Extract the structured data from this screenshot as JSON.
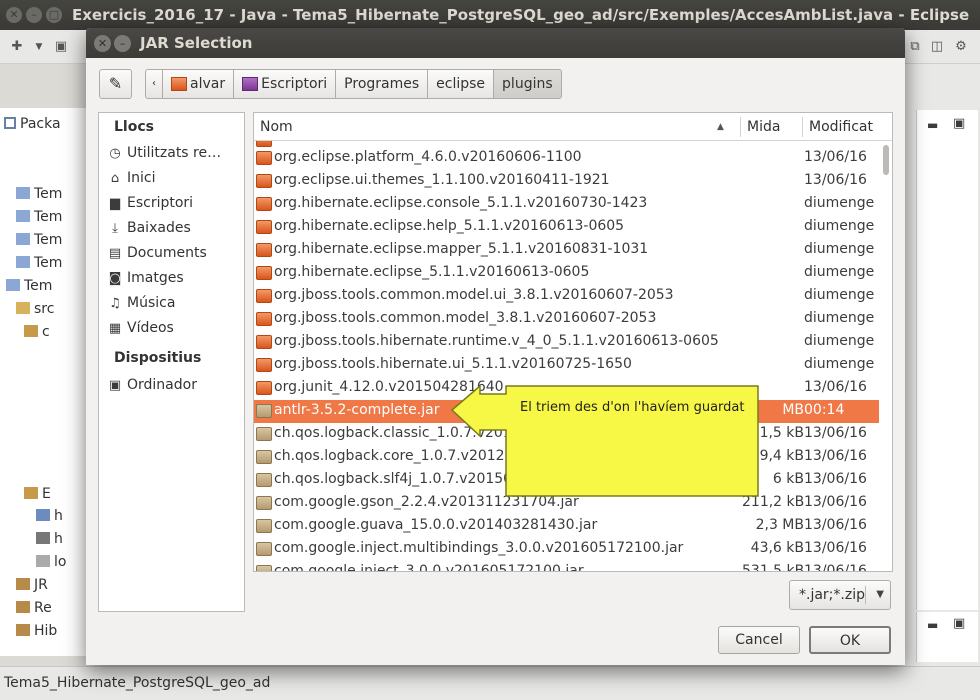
{
  "eclipse": {
    "title": "Exercicis_2016_17 - Java - Tema5_Hibernate_PostgreSQL_geo_ad/src/Exemples/AccesAmbList.java - Eclipse",
    "package_explorer_tab": "Packa",
    "tree": [
      {
        "label": "Tem",
        "icon": "project-icon"
      },
      {
        "label": "Tem",
        "icon": "project-icon"
      },
      {
        "label": "Tem",
        "icon": "project-icon"
      },
      {
        "label": "Tem",
        "icon": "project-icon"
      },
      {
        "label": "Tem",
        "icon": "project-icon"
      },
      {
        "label": "src",
        "icon": "source-folder-icon"
      },
      {
        "label": "c",
        "icon": "package-icon"
      },
      {
        "label": "E",
        "icon": "package-icon"
      },
      {
        "label": "h",
        "icon": "xml-file-icon"
      },
      {
        "label": "h",
        "icon": "config-icon"
      },
      {
        "label": "lo",
        "icon": "file-icon"
      },
      {
        "label": "JR",
        "icon": "library-icon"
      },
      {
        "label": "Re",
        "icon": "library-icon"
      },
      {
        "label": "Hib",
        "icon": "library-icon"
      }
    ],
    "status_text": "Tema5_Hibernate_PostgreSQL_geo_ad"
  },
  "dialog": {
    "title": "JAR Selection",
    "path": [
      "alvar",
      "Escriptori",
      "Programes",
      "eclipse",
      "plugins"
    ],
    "places_heading": "Llocs",
    "places": [
      {
        "label": "Utilitzats re…",
        "icon": "clock-icon"
      },
      {
        "label": "Inici",
        "icon": "home-icon"
      },
      {
        "label": "Escriptori",
        "icon": "desktop-icon"
      },
      {
        "label": "Baixades",
        "icon": "download-icon"
      },
      {
        "label": "Documents",
        "icon": "document-icon"
      },
      {
        "label": "Imatges",
        "icon": "camera-icon"
      },
      {
        "label": "Música",
        "icon": "music-icon"
      },
      {
        "label": "Vídeos",
        "icon": "film-icon"
      }
    ],
    "devices_heading": "Dispositius",
    "devices": [
      {
        "label": "Ordinador",
        "icon": "computer-icon"
      }
    ],
    "columns": {
      "name": "Nom",
      "size": "Mida",
      "modified": "Modificat"
    },
    "files": [
      {
        "name": "org.eclipse.platform_4.6.0.v20160606-1100",
        "size": "",
        "modified": "13/06/16",
        "type": "folder",
        "selected": false
      },
      {
        "name": "org.eclipse.ui.themes_1.1.100.v20160411-1921",
        "size": "",
        "modified": "13/06/16",
        "type": "folder",
        "selected": false
      },
      {
        "name": "org.hibernate.eclipse.console_5.1.1.v20160730-1423",
        "size": "",
        "modified": "diumenge",
        "type": "folder",
        "selected": false
      },
      {
        "name": "org.hibernate.eclipse.help_5.1.1.v20160613-0605",
        "size": "",
        "modified": "diumenge",
        "type": "folder",
        "selected": false
      },
      {
        "name": "org.hibernate.eclipse.mapper_5.1.1.v20160831-1031",
        "size": "",
        "modified": "diumenge",
        "type": "folder",
        "selected": false
      },
      {
        "name": "org.hibernate.eclipse_5.1.1.v20160613-0605",
        "size": "",
        "modified": "diumenge",
        "type": "folder",
        "selected": false
      },
      {
        "name": "org.jboss.tools.common.model.ui_3.8.1.v20160607-2053",
        "size": "",
        "modified": "diumenge",
        "type": "folder",
        "selected": false
      },
      {
        "name": "org.jboss.tools.common.model_3.8.1.v20160607-2053",
        "size": "",
        "modified": "diumenge",
        "type": "folder",
        "selected": false
      },
      {
        "name": "org.jboss.tools.hibernate.runtime.v_4_0_5.1.1.v20160613-0605",
        "size": "",
        "modified": "diumenge",
        "type": "folder",
        "selected": false
      },
      {
        "name": "org.jboss.tools.hibernate.ui_5.1.1.v20160725-1650",
        "size": "",
        "modified": "diumenge",
        "type": "folder",
        "selected": false
      },
      {
        "name": "org.junit_4.12.0.v201504281640",
        "size": "",
        "modified": "13/06/16",
        "type": "folder",
        "selected": false
      },
      {
        "name": "antlr-3.5.2-complete.jar",
        "size": "MB",
        "modified": "00:14",
        "type": "archive",
        "selected": true
      },
      {
        "name": "ch.qos.logback.classic_1.0.7.v2012",
        "size": "1,5 kB",
        "modified": "13/06/16",
        "type": "archive",
        "selected": false
      },
      {
        "name": "ch.qos.logback.core_1.0.7.v201211",
        "size": "9,4 kB",
        "modified": "13/06/16",
        "type": "archive",
        "selected": false
      },
      {
        "name": "ch.qos.logback.slf4j_1.0.7.v201505",
        "size": "6 kB",
        "modified": "13/06/16",
        "type": "archive",
        "selected": false
      },
      {
        "name": "com.google.gson_2.2.4.v201311231704.jar",
        "size": "211,2 kB",
        "modified": "13/06/16",
        "type": "archive",
        "selected": false
      },
      {
        "name": "com.google.guava_15.0.0.v201403281430.jar",
        "size": "2,3 MB",
        "modified": "13/06/16",
        "type": "archive",
        "selected": false
      },
      {
        "name": "com.google.inject.multibindings_3.0.0.v201605172100.jar",
        "size": "43,6 kB",
        "modified": "13/06/16",
        "type": "archive",
        "selected": false
      },
      {
        "name": "com.google.inject_3.0.0.v201605172100.jar",
        "size": "531,5 kB",
        "modified": "13/06/16",
        "type": "archive",
        "selected": false
      }
    ],
    "filter": "*.jar;*.zip",
    "cancel_label": "Cancel",
    "ok_label": "OK"
  },
  "annotation": {
    "text": "El triem des d'on l'havíem guardat",
    "color": "#f7f745"
  }
}
